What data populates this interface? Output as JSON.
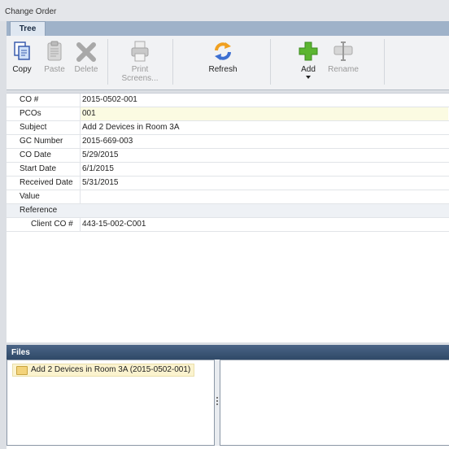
{
  "window": {
    "title": "Change Order"
  },
  "tabs": [
    {
      "label": "Tree"
    }
  ],
  "toolbar": {
    "copy": {
      "label": "Copy",
      "icon": "copy-icon"
    },
    "paste": {
      "label": "Paste",
      "icon": "paste-icon"
    },
    "delete": {
      "label": "Delete",
      "icon": "delete-icon"
    },
    "print": {
      "label": "Print Screens...",
      "icon": "printer-icon"
    },
    "refresh": {
      "label": "Refresh",
      "icon": "refresh-icon"
    },
    "add": {
      "label": "Add",
      "icon": "add-icon"
    },
    "rename": {
      "label": "Rename",
      "icon": "rename-icon"
    }
  },
  "properties": [
    {
      "label": "CO #",
      "value": "2015-0502-001"
    },
    {
      "label": "PCOs",
      "value": "001"
    },
    {
      "label": "Subject",
      "value": "Add 2 Devices in Room 3A"
    },
    {
      "label": "GC Number",
      "value": "2015-669-003"
    },
    {
      "label": "CO Date",
      "value": "5/29/2015"
    },
    {
      "label": "Start Date",
      "value": "6/1/2015"
    },
    {
      "label": "Received Date",
      "value": "5/31/2015"
    },
    {
      "label": "Value",
      "value": ""
    }
  ],
  "reference": {
    "category": "Reference",
    "client_co_label": "Client CO #",
    "client_co_value": "443-15-002-C001"
  },
  "files": {
    "header": "Files",
    "items": [
      {
        "label": "Add 2 Devices in Room 3A (2015-0502-001)"
      }
    ]
  },
  "colors": {
    "ribbon": "#f1f2f4",
    "files_header": "#3a5575",
    "highlight_row": "#fbfbe2",
    "add_green": "#5cb531",
    "refresh_orange": "#f0a020"
  }
}
